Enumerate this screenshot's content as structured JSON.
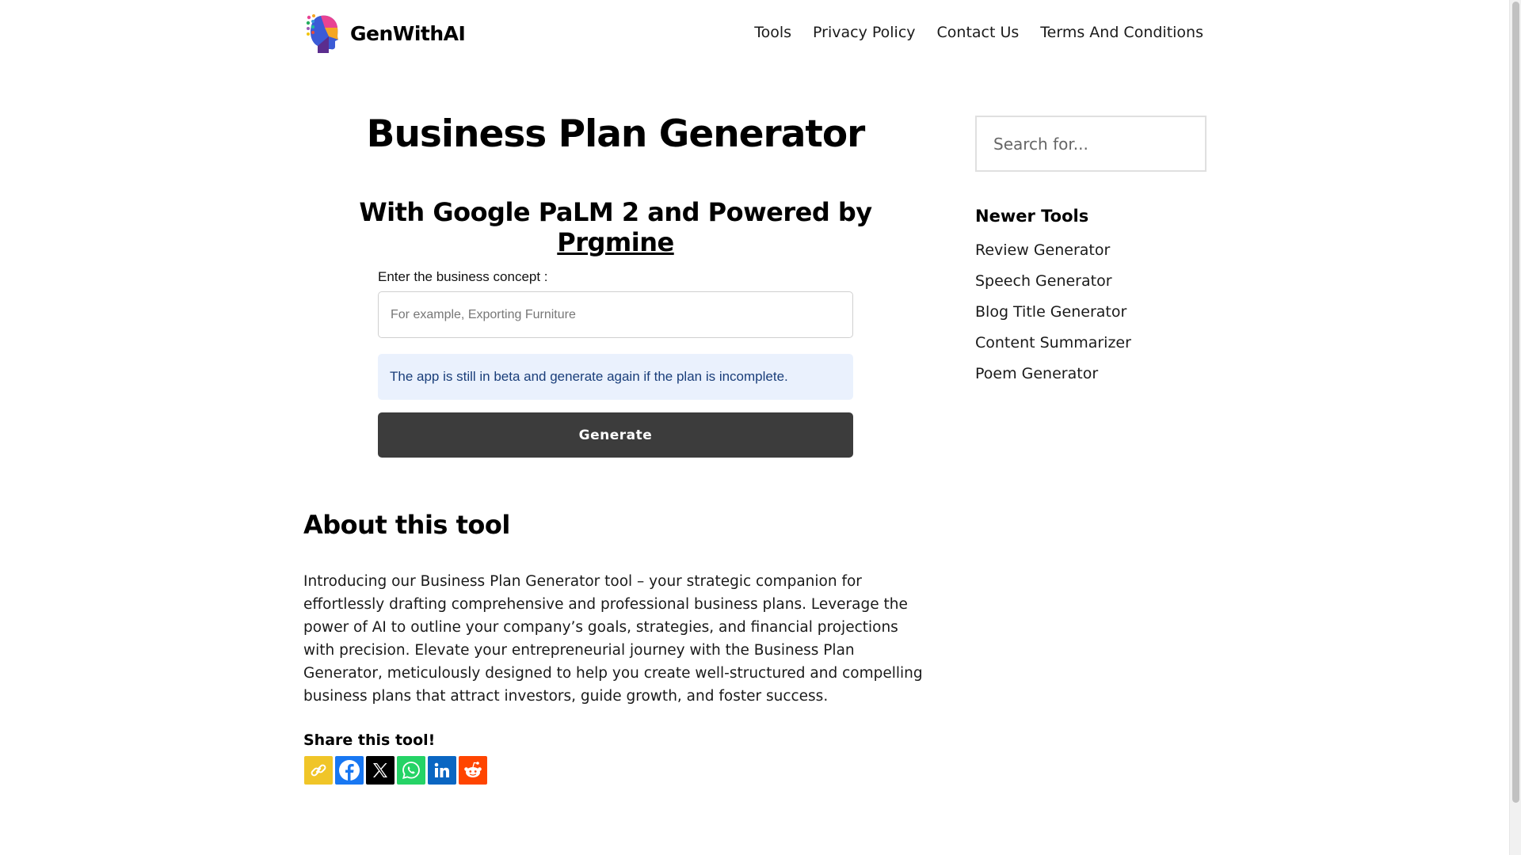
{
  "header": {
    "brand": "GenWithAI",
    "nav": [
      {
        "label": "Tools"
      },
      {
        "label": "Privacy Policy"
      },
      {
        "label": "Contact Us"
      },
      {
        "label": "Terms And Conditions"
      }
    ]
  },
  "main": {
    "title": "Business Plan Generator",
    "subtitle_prefix": "With Google PaLM 2 and Powered by ",
    "subtitle_link": "Prgmine",
    "form": {
      "label": "Enter the business concept :",
      "placeholder": "For example, Exporting Furniture",
      "value": "",
      "alert": "The app is still in beta and generate again if the plan is incomplete.",
      "button": "Generate"
    },
    "about": {
      "heading": "About this tool",
      "text": "Introducing our Business Plan Generator tool – your strategic companion for effortlessly drafting comprehensive and professional business plans. Leverage the power of AI to outline your company’s goals, strategies, and financial projections with precision. Elevate your entrepreneurial journey with the Business Plan Generator, meticulously designed to help you create well-structured and compelling business plans that attract investors, guide growth, and foster success."
    },
    "share": {
      "heading": "Share this tool!",
      "buttons": [
        {
          "icon": "copy-link-icon",
          "color": "#f0c528"
        },
        {
          "icon": "facebook-icon",
          "color": "#1877f2"
        },
        {
          "icon": "x-icon",
          "color": "#000000"
        },
        {
          "icon": "whatsapp-icon",
          "color": "#25d366"
        },
        {
          "icon": "linkedin-icon",
          "color": "#0a66c2"
        },
        {
          "icon": "reddit-icon",
          "color": "#ff4500"
        }
      ]
    }
  },
  "sidebar": {
    "search_placeholder": "Search for...",
    "heading": "Newer Tools",
    "items": [
      {
        "label": "Review Generator"
      },
      {
        "label": "Speech Generator"
      },
      {
        "label": "Blog Title Generator"
      },
      {
        "label": "Content Summarizer"
      },
      {
        "label": "Poem Generator"
      }
    ]
  }
}
